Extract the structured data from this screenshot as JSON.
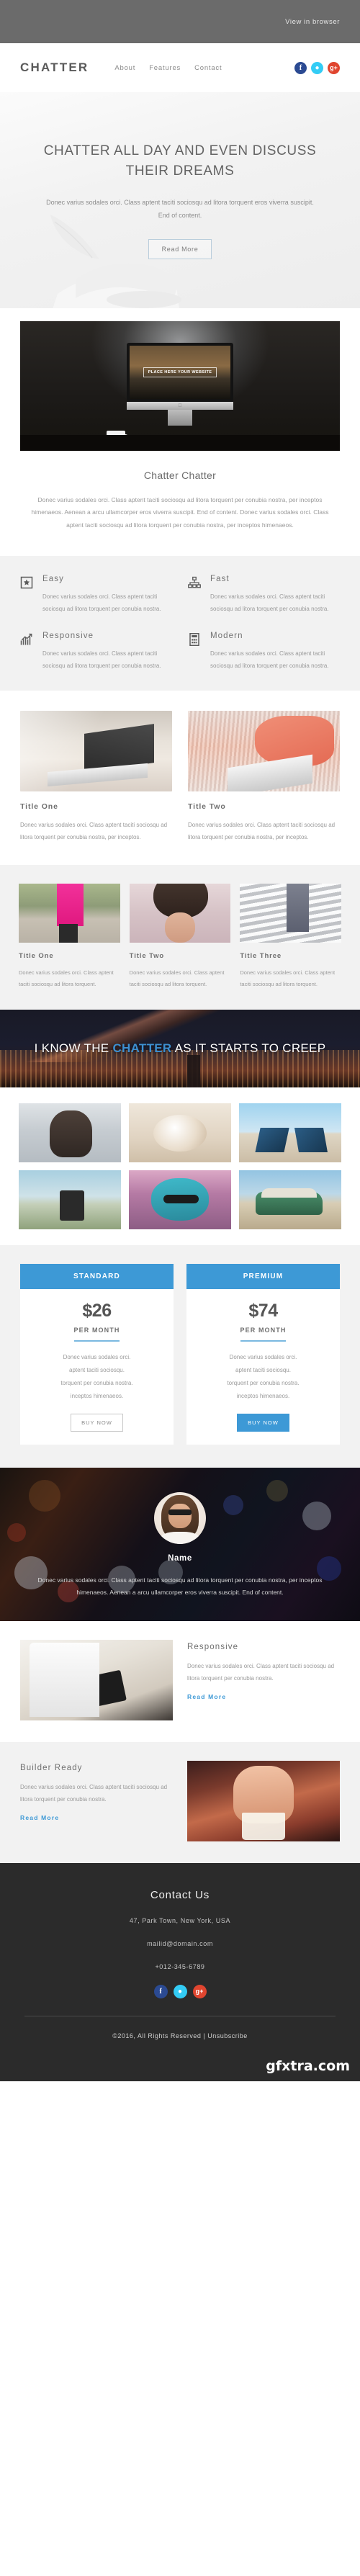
{
  "preheader": {
    "view_in_browser": "View in browser"
  },
  "nav": {
    "logo": "CHATTER",
    "links": [
      "About",
      "Features",
      "Contact"
    ],
    "social": [
      "facebook-icon",
      "twitter-icon",
      "google-plus-icon"
    ]
  },
  "hero": {
    "heading": "CHATTER ALL DAY AND EVEN DISCUSS THEIR DREAMS",
    "body": "Donec varius sodales orci. Class aptent taciti sociosqu ad litora torquent eros viverra suscipit. End of content.",
    "button": "Read More"
  },
  "desk": {
    "screen_label": "PLACE HERE YOUR WEBSITE"
  },
  "intro": {
    "title": "Chatter Chatter",
    "body": "Donec varius sodales orci. Class aptent taciti sociosqu ad litora torquent per conubia nostra, per inceptos himenaeos. Aenean a arcu ullamcorper eros viverra suscipit. End of content. Donec varius sodales orci. Class aptent taciti sociosqu ad litora torquent per conubia nostra, per inceptos himenaeos."
  },
  "features": [
    {
      "icon": "star-box-icon",
      "title": "Easy",
      "text": "Donec varius sodales orci. Class aptent taciti sociosqu ad litora torquent per conubia nostra."
    },
    {
      "icon": "sitemap-icon",
      "title": "Fast",
      "text": "Donec varius sodales orci. Class aptent taciti sociosqu ad litora torquent per conubia nostra."
    },
    {
      "icon": "growth-chart-icon",
      "title": "Responsive",
      "text": "Donec varius sodales orci. Class aptent taciti sociosqu ad litora torquent per conubia nostra."
    },
    {
      "icon": "calculator-icon",
      "title": "Modern",
      "text": "Donec varius sodales orci. Class aptent taciti sociosqu ad litora torquent per conubia nostra."
    }
  ],
  "two_col": [
    {
      "title": "Title One",
      "text": "Donec varius sodales orci. Class aptent taciti sociosqu ad litora torquent per conubia nostra, per inceptos."
    },
    {
      "title": "Title Two",
      "text": "Donec varius sodales orci. Class aptent taciti sociosqu ad litora torquent per conubia nostra, per inceptos."
    }
  ],
  "three_col": [
    {
      "title": "Title One",
      "text": "Donec varius sodales orci. Class aptent taciti sociosqu ad litora torquent."
    },
    {
      "title": "Title Two",
      "text": "Donec varius sodales orci. Class aptent taciti sociosqu ad litora torquent."
    },
    {
      "title": "Title Three",
      "text": "Donec varius sodales orci. Class aptent taciti sociosqu ad litora torquent."
    }
  ],
  "banner": {
    "before": "I KNOW THE ",
    "highlight": "CHATTER",
    "after": " AS IT STARTS TO CREEP",
    "highlight_color": "#3d8fd0"
  },
  "pricing": {
    "accent_color": "#3d99d6",
    "plans": [
      {
        "name": "STANDARD",
        "price": "$26",
        "period": "PER MONTH",
        "features": [
          "Donec varius sodales orci.",
          "aptent taciti sociosqu.",
          "torquent per conubia nostra.",
          "inceptos himenaeos."
        ],
        "button": "BUY NOW",
        "button_style": "ghost"
      },
      {
        "name": "PREMIUM",
        "price": "$74",
        "period": "PER MONTH",
        "features": [
          "Donec varius sodales orci.",
          "aptent taciti sociosqu.",
          "torquent per conubia nostra.",
          "inceptos himenaeos."
        ],
        "button": "BUY NOW",
        "button_style": "solid"
      }
    ]
  },
  "testimonial": {
    "name": "Name",
    "quote": "Donec varius sodales orci. Class aptent taciti sociosqu ad litora torquent per conubia nostra, per inceptos himenaeos. Aenean a arcu ullamcorper eros viverra suscipit. End of content."
  },
  "blocks": [
    {
      "title": "Responsive",
      "text": "Donec varius sodales orci. Class aptent taciti sociosqu ad litora torquent per conubia nostra.",
      "link": "Read More"
    },
    {
      "title": "Builder Ready",
      "text": "Donec varius sodales orci. Class aptent taciti sociosqu ad litora torquent per conubia nostra.",
      "link": "Read More"
    }
  ],
  "footer": {
    "title": "Contact Us",
    "address": "47, Park Town, New York, USA",
    "email": "mailid@domain.com",
    "phone": "+012-345-6789",
    "social": [
      "facebook-icon",
      "twitter-icon",
      "google-plus-icon"
    ],
    "copyright": "©2016, All Rights Reserved | Unsubscribe"
  },
  "watermark": "gfxtra.com"
}
